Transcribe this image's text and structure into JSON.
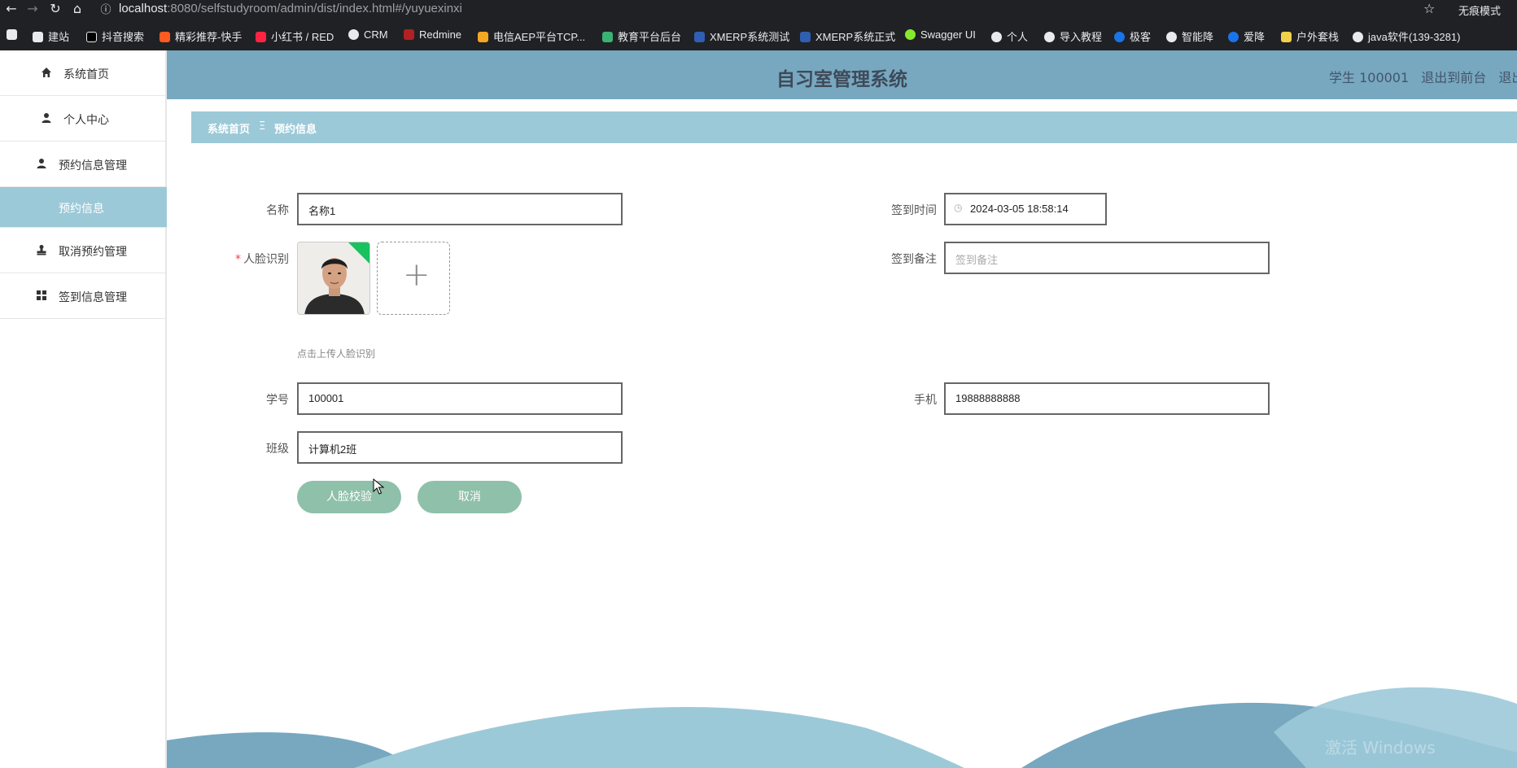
{
  "browser": {
    "url_host": "localhost",
    "url_path": ":8080/selfstudyroom/admin/dist/index.html#/yuyuexinxi",
    "incognito_label": "无痕模式",
    "bookmarks": [
      "建站",
      "抖音搜索",
      "精彩推荐-快手",
      "小红书 / RED",
      "CRM",
      "Redmine",
      "电信AEP平台TCP...",
      "教育平台后台",
      "XMERP系统测试",
      "XMERP系统正式",
      "Swagger UI",
      "个人",
      "导入教程",
      "极客",
      "智能降",
      "爱降",
      "户外套栈",
      "java软件(139-3281)"
    ]
  },
  "sidebar": {
    "items": [
      {
        "label": "系统首页",
        "icon": "home-icon"
      },
      {
        "label": "个人中心",
        "icon": "user-icon"
      },
      {
        "label": "预约信息管理",
        "icon": "user-icon"
      },
      {
        "label": "预约信息",
        "icon": ""
      },
      {
        "label": "取消预约管理",
        "icon": "stamp-icon"
      },
      {
        "label": "签到信息管理",
        "icon": "grid-icon"
      }
    ]
  },
  "header": {
    "title": "自习室管理系统",
    "user": "学生 100001",
    "back_front": "退出到前台",
    "logout": "退出登"
  },
  "breadcrumb": {
    "home": "系统首页",
    "separator": "Ξ",
    "current": "预约信息"
  },
  "form": {
    "name_label": "名称",
    "name_value": "名称1",
    "face_label": "人脸识别",
    "face_hint": "点击上传人脸识别",
    "student_no_label": "学号",
    "student_no_value": "100001",
    "class_label": "班级",
    "class_value": "计算机2班",
    "checkin_time_label": "签到时间",
    "checkin_time_value": "2024-03-05 18:58:14",
    "checkin_note_label": "签到备注",
    "checkin_note_placeholder": "签到备注",
    "phone_label": "手机",
    "phone_value": "19888888888",
    "verify_button": "人脸校验",
    "cancel_button": "取消"
  },
  "watermark": "激活 Windows"
}
